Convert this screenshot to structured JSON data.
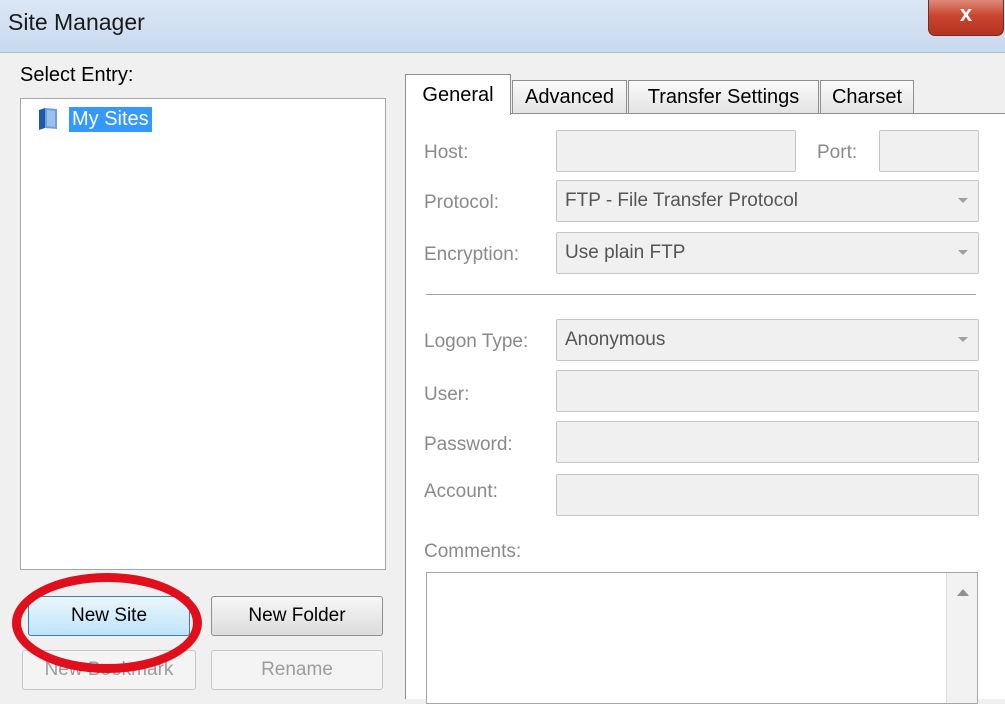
{
  "window": {
    "title": "Site Manager",
    "close_label": "x"
  },
  "left_pane": {
    "select_entry_label": "Select Entry:",
    "tree": {
      "items": [
        {
          "label": "My Sites",
          "icon": "folder-icon",
          "selected": true
        }
      ]
    },
    "buttons": {
      "new_site": "New Site",
      "new_folder": "New Folder",
      "new_bookmark": "New Bookmark",
      "rename": "Rename"
    }
  },
  "tabs": [
    "General",
    "Advanced",
    "Transfer Settings",
    "Charset"
  ],
  "active_tab": "General",
  "general": {
    "host_label": "Host:",
    "host_value": "",
    "port_label": "Port:",
    "port_value": "",
    "protocol_label": "Protocol:",
    "protocol_value": "FTP - File Transfer Protocol",
    "encryption_label": "Encryption:",
    "encryption_value": "Use plain FTP",
    "logon_type_label": "Logon Type:",
    "logon_type_value": "Anonymous",
    "user_label": "User:",
    "user_value": "",
    "password_label": "Password:",
    "password_value": "",
    "account_label": "Account:",
    "account_value": "",
    "comments_label": "Comments:",
    "comments_value": ""
  },
  "colors": {
    "annotation_circle": "#e00f1b",
    "selection": "#3399ff"
  }
}
